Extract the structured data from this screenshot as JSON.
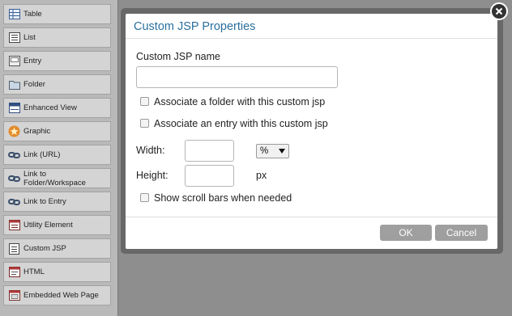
{
  "palette": {
    "items": [
      {
        "label": "Table",
        "icon": "table-icon"
      },
      {
        "label": "List",
        "icon": "list-icon"
      },
      {
        "label": "Entry",
        "icon": "entry-icon"
      },
      {
        "label": "Folder",
        "icon": "folder-icon"
      },
      {
        "label": "Enhanced View",
        "icon": "enhanced-view-icon"
      },
      {
        "label": "Graphic",
        "icon": "graphic-icon"
      },
      {
        "label": "Link (URL)",
        "icon": "link-icon"
      },
      {
        "label": "Link to Folder/Workspace",
        "icon": "link-icon"
      },
      {
        "label": "Link to Entry",
        "icon": "link-icon"
      },
      {
        "label": "Utility Element",
        "icon": "utility-icon"
      },
      {
        "label": "Custom JSP",
        "icon": "document-icon"
      },
      {
        "label": "HTML",
        "icon": "html-icon"
      },
      {
        "label": "Embedded Web Page",
        "icon": "web-page-icon"
      }
    ]
  },
  "dialog": {
    "title": "Custom JSP Properties",
    "name_label": "Custom JSP name",
    "name_value": "",
    "folder_checkbox_label": "Associate a folder with this custom jsp",
    "folder_checked": false,
    "entry_checkbox_label": "Associate an entry with this custom jsp",
    "entry_checked": false,
    "width_label": "Width:",
    "width_value": "",
    "width_unit": "%",
    "height_label": "Height:",
    "height_value": "",
    "height_unit": "px",
    "scroll_label": "Show scroll bars when needed",
    "scroll_checked": false,
    "ok_label": "OK",
    "cancel_label": "Cancel"
  },
  "colors": {
    "title": "#2a6f9d",
    "button": "#9f9f9f",
    "overlay": "#8c8c8c"
  }
}
